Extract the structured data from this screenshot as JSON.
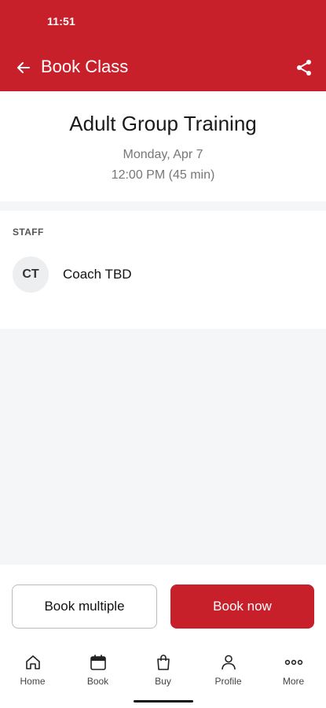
{
  "status_bar": {
    "time": "11:51"
  },
  "header": {
    "title": "Book Class",
    "back_icon": "arrow-left-icon",
    "share_icon": "share-icon",
    "color": "#c8202a"
  },
  "class_info": {
    "name": "Adult Group Training",
    "date": "Monday, Apr 7",
    "time": "12:00 PM (45 min)"
  },
  "staff": {
    "section_label": "STAFF",
    "members": [
      {
        "initials": "CT",
        "name": "Coach TBD"
      }
    ]
  },
  "actions": {
    "book_multiple": "Book multiple",
    "book_now": "Book now"
  },
  "tabbar": {
    "items": [
      {
        "label": "Home",
        "icon": "home-icon"
      },
      {
        "label": "Book",
        "icon": "calendar-icon"
      },
      {
        "label": "Buy",
        "icon": "shopping-bag-icon"
      },
      {
        "label": "Profile",
        "icon": "person-icon"
      },
      {
        "label": "More",
        "icon": "more-dots-icon"
      }
    ]
  }
}
